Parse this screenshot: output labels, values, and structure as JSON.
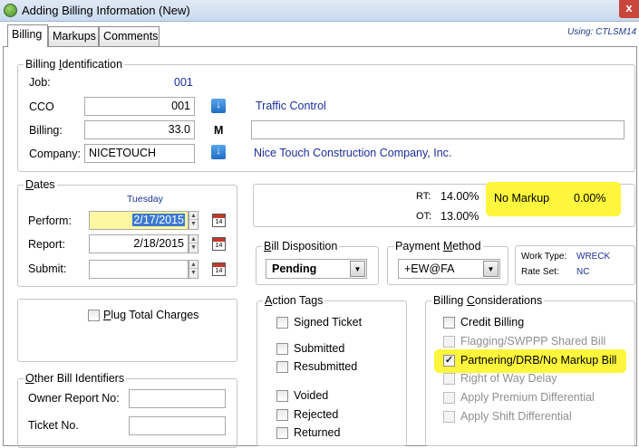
{
  "window": {
    "title": "Adding Billing Information  (New)",
    "close": "x"
  },
  "tabs": [
    "Billing",
    "Markups",
    "Comments"
  ],
  "using": "Using:  CTLSM14",
  "billing_id": {
    "legend_pre": "Billing ",
    "legend_u": "I",
    "legend_post": "dentification",
    "job_label": "Job:",
    "job_value": "001",
    "cco_label": "CCO",
    "cco_value": "001",
    "cco_desc": "Traffic Control",
    "billing_label": "Billing:",
    "billing_value": "33.0",
    "billing_flag": "M",
    "billing_desc": "",
    "company_label": "Company:",
    "company_value": "NICETOUCH",
    "company_desc": "Nice Touch Construction Company, Inc."
  },
  "dates": {
    "legend_u": "D",
    "legend_post": "ates",
    "weekday": "Tuesday",
    "perform_label": "Perform:",
    "perform_value": "2/17/2015",
    "report_label": "Report:",
    "report_value": "2/18/2015",
    "submit_label": "Submit:",
    "submit_value": "",
    "calendar_glyph": "14"
  },
  "rates": {
    "rt_label": "RT:",
    "rt_value": "14.00%",
    "ot_label": "OT:",
    "ot_value": "13.00%",
    "markup_label": "No Markup",
    "markup_value": "0.00%"
  },
  "bill_disposition": {
    "legend_u": "B",
    "legend_post": "ill Disposition",
    "value": "Pending"
  },
  "payment_method": {
    "legend_pre": "Payment ",
    "legend_u": "M",
    "legend_post": "ethod",
    "value": "+EW@FA"
  },
  "work_info": {
    "type_label": "Work Type:",
    "type_value": "WRECK",
    "rate_label": "Rate Set:",
    "rate_value": "NC"
  },
  "plug_total": {
    "label_u": "P",
    "label_post": "lug Total Charges",
    "checked": false
  },
  "action_tags": {
    "legend_u": "A",
    "legend_post": "ction Tags",
    "items": [
      {
        "label": "Signed Ticket",
        "checked": false
      },
      {
        "label": "Submitted",
        "checked": false
      },
      {
        "label": "Resubmitted",
        "checked": false
      },
      {
        "label": "Voided",
        "checked": false
      },
      {
        "label": "Rejected",
        "checked": false
      },
      {
        "label": "Returned",
        "checked": false
      }
    ]
  },
  "billing_considerations": {
    "legend_pre": "Billing ",
    "legend_u": "C",
    "legend_post": "onsiderations",
    "items": [
      {
        "label": "Credit Billing",
        "checked": false,
        "enabled": true
      },
      {
        "label": "Flagging/SWPPP Shared Bill",
        "checked": false,
        "enabled": false
      },
      {
        "label": "Partnering/DRB/No Markup Bill",
        "checked": true,
        "enabled": true
      },
      {
        "label": "Right of Way Delay",
        "checked": false,
        "enabled": false
      },
      {
        "label": "Apply Premium Differential",
        "checked": false,
        "enabled": false
      },
      {
        "label": "Apply Shift Differential",
        "checked": false,
        "enabled": false
      }
    ]
  },
  "other_ids": {
    "legend_u": "O",
    "legend_post": "ther Bill Identifiers",
    "owner_label": "Owner Report No:",
    "owner_value": "",
    "ticket_label": "Ticket No.",
    "ticket_value": ""
  },
  "colors": {
    "highlight": "#fdf63c",
    "link_blue": "#1c2f9a",
    "selection": "#3b79d0"
  }
}
